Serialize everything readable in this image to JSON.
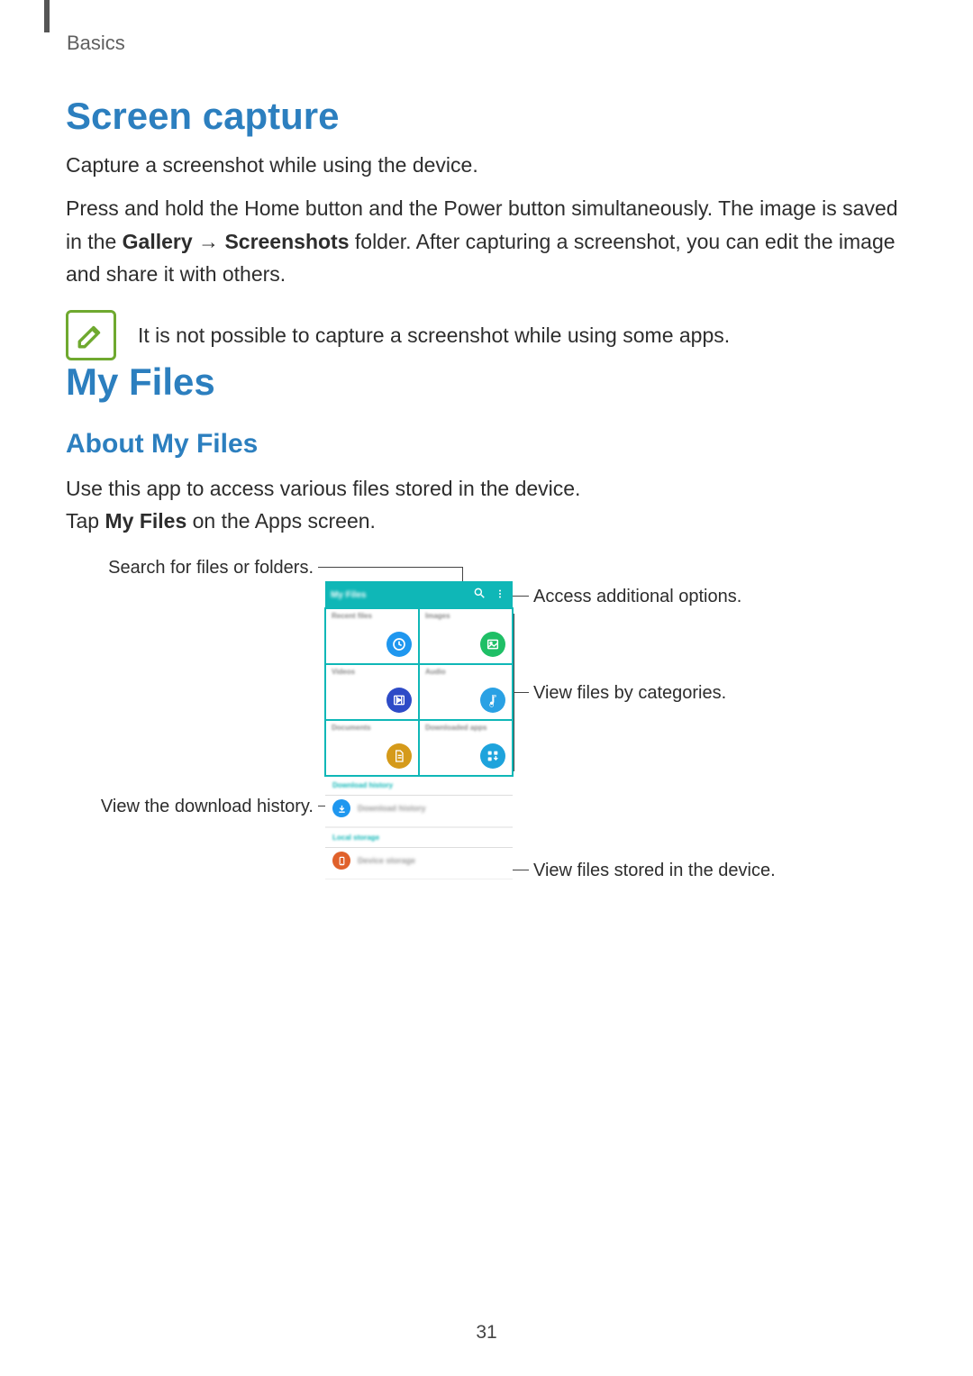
{
  "breadcrumb": "Basics",
  "page_number": "31",
  "screen_capture": {
    "heading": "Screen capture",
    "intro": "Capture a screenshot while using the device.",
    "body_pre": "Press and hold the Home button and the Power button simultaneously. The image is saved in the ",
    "body_bold1": "Gallery",
    "body_mid": " → ",
    "body_bold2": "Screenshots",
    "body_post": " folder. After capturing a screenshot, you can edit the image and share it with others.",
    "note": "It is not possible to capture a screenshot while using some apps."
  },
  "my_files": {
    "heading": "My Files",
    "subheading": "About My Files",
    "line1": "Use this app to access various files stored in the device.",
    "line2_pre": "Tap ",
    "line2_bold": "My Files",
    "line2_post": " on the Apps screen."
  },
  "callouts": {
    "search": "Search for files or folders.",
    "options": "Access additional options.",
    "categories": "View files by categories.",
    "download_history": "View the download history.",
    "device_files": "View files stored in the device."
  },
  "phone": {
    "title": "My Files",
    "categories": [
      {
        "label": "Recent files",
        "color": "#1f97ef",
        "icon": "clock"
      },
      {
        "label": "Images",
        "color": "#1fbf66",
        "icon": "image"
      },
      {
        "label": "Videos",
        "color": "#2e4bc7",
        "icon": "film"
      },
      {
        "label": "Audio",
        "color": "#2aa1e4",
        "icon": "note"
      },
      {
        "label": "Documents",
        "color": "#d59a1a",
        "icon": "doc"
      },
      {
        "label": "Downloaded apps",
        "color": "#1ea3dc",
        "icon": "apps"
      }
    ],
    "download_section": "Download history",
    "download_row": "Download history",
    "local_section": "Local storage",
    "local_row": "Device storage"
  }
}
